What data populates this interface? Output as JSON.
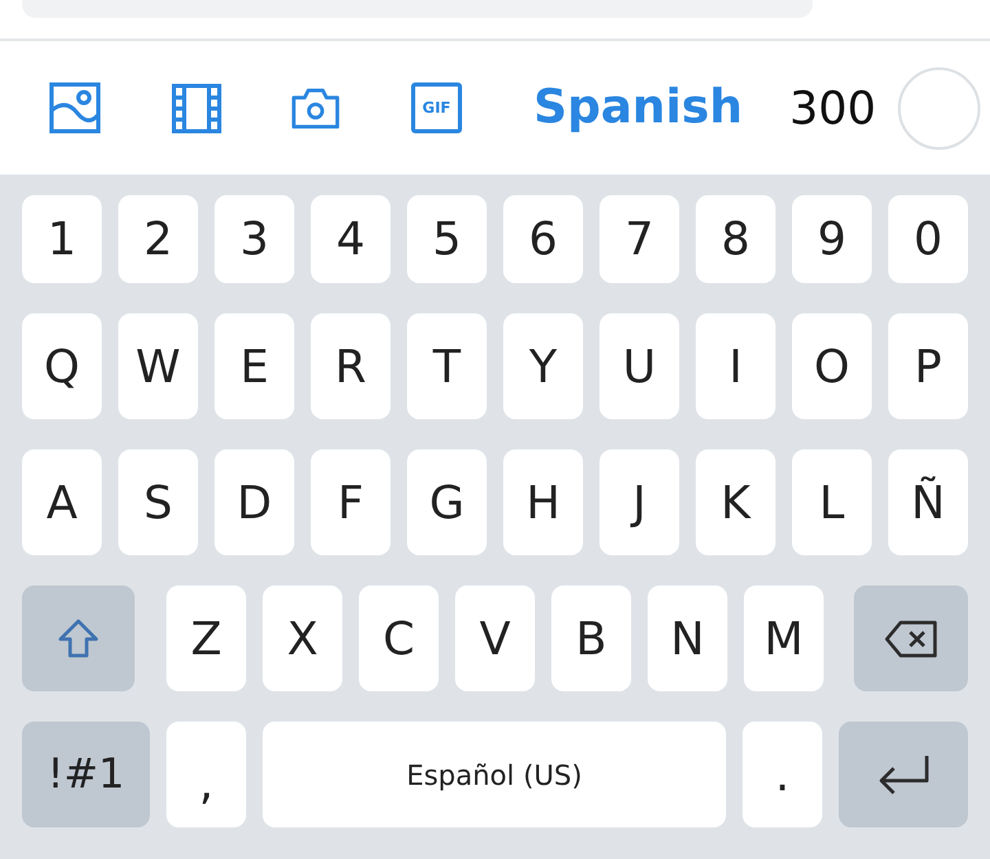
{
  "toolbar": {
    "buttons": [
      {
        "kind": "image"
      },
      {
        "kind": "film"
      },
      {
        "kind": "camera"
      },
      {
        "kind": "gif",
        "label": "GIF"
      }
    ],
    "language": "Spanish",
    "char_count": "300"
  },
  "keyboard": {
    "rows": [
      {
        "keys": [
          {
            "kind": "char",
            "label": "1"
          },
          {
            "kind": "char",
            "label": "2"
          },
          {
            "kind": "char",
            "label": "3"
          },
          {
            "kind": "char",
            "label": "4"
          },
          {
            "kind": "char",
            "label": "5"
          },
          {
            "kind": "char",
            "label": "6"
          },
          {
            "kind": "char",
            "label": "7"
          },
          {
            "kind": "char",
            "label": "8"
          },
          {
            "kind": "char",
            "label": "9"
          },
          {
            "kind": "char",
            "label": "0"
          }
        ]
      },
      {
        "keys": [
          {
            "kind": "char",
            "label": "Q"
          },
          {
            "kind": "char",
            "label": "W"
          },
          {
            "kind": "char",
            "label": "E"
          },
          {
            "kind": "char",
            "label": "R"
          },
          {
            "kind": "char",
            "label": "T"
          },
          {
            "kind": "char",
            "label": "Y"
          },
          {
            "kind": "char",
            "label": "U"
          },
          {
            "kind": "char",
            "label": "I"
          },
          {
            "kind": "char",
            "label": "O"
          },
          {
            "kind": "char",
            "label": "P"
          }
        ]
      },
      {
        "keys": [
          {
            "kind": "char",
            "label": "A"
          },
          {
            "kind": "char",
            "label": "S"
          },
          {
            "kind": "char",
            "label": "D"
          },
          {
            "kind": "char",
            "label": "F"
          },
          {
            "kind": "char",
            "label": "G"
          },
          {
            "kind": "char",
            "label": "H"
          },
          {
            "kind": "char",
            "label": "J"
          },
          {
            "kind": "char",
            "label": "K"
          },
          {
            "kind": "char",
            "label": "L"
          },
          {
            "kind": "char",
            "label": "Ñ"
          }
        ]
      },
      {
        "keys": [
          {
            "kind": "shift"
          },
          {
            "kind": "char",
            "label": "Z"
          },
          {
            "kind": "char",
            "label": "X"
          },
          {
            "kind": "char",
            "label": "C"
          },
          {
            "kind": "char",
            "label": "V"
          },
          {
            "kind": "char",
            "label": "B"
          },
          {
            "kind": "char",
            "label": "N"
          },
          {
            "kind": "char",
            "label": "M"
          },
          {
            "kind": "backspace"
          }
        ]
      },
      {
        "keys": [
          {
            "kind": "symbols",
            "label": "!#1"
          },
          {
            "kind": "char",
            "label": ","
          },
          {
            "kind": "space",
            "label": "Español (US)"
          },
          {
            "kind": "char",
            "label": "."
          },
          {
            "kind": "enter"
          }
        ]
      }
    ]
  }
}
